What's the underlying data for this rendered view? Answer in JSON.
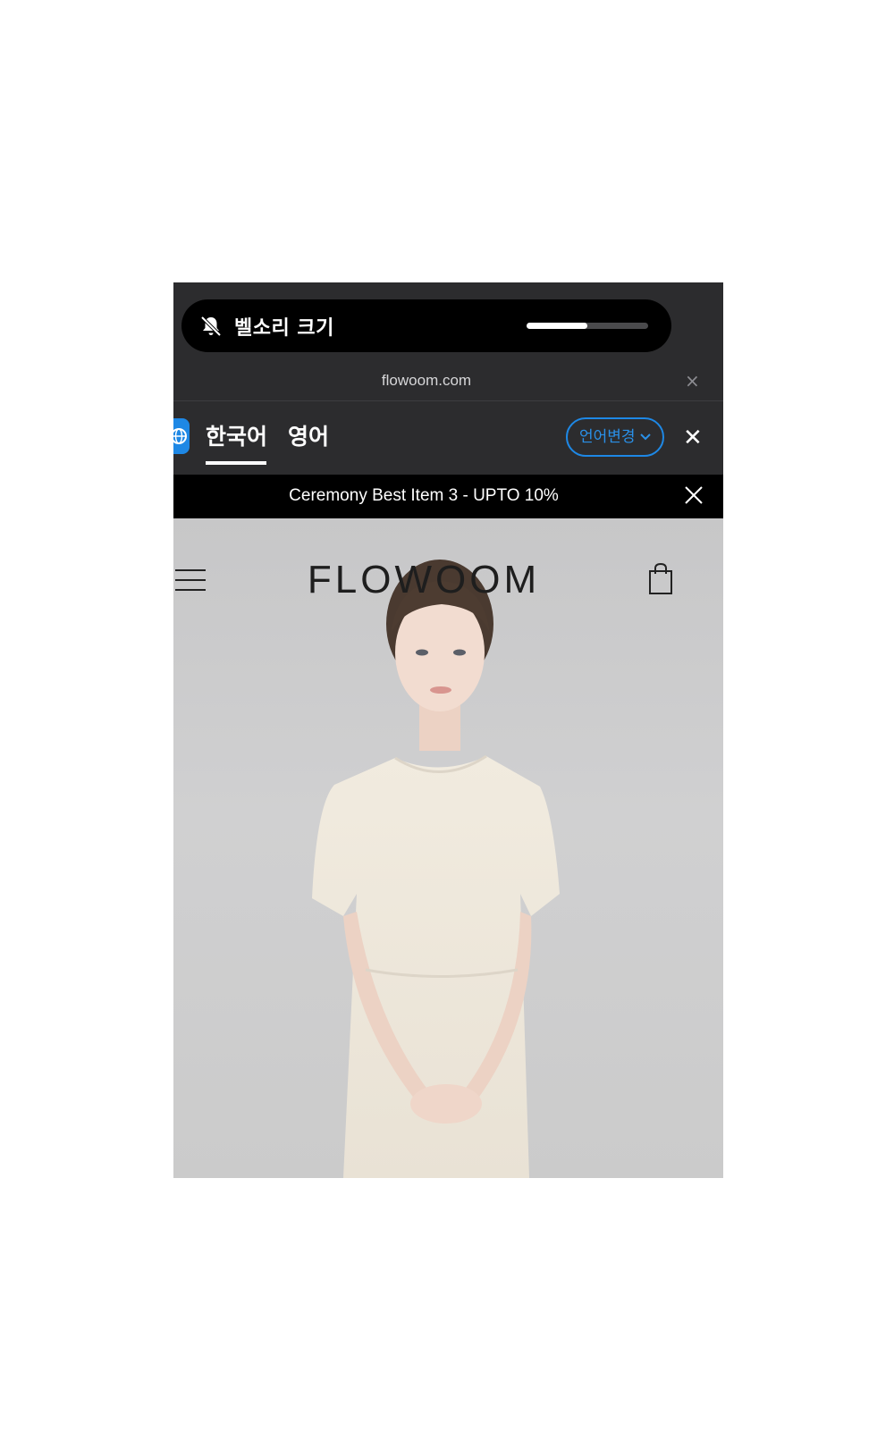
{
  "hud": {
    "label": "벨소리 크기",
    "volume_fraction": 0.5,
    "icon": "bell-slash-icon"
  },
  "url_bar": {
    "url": "flowoom.com",
    "close_label": "×"
  },
  "translate_bar": {
    "tabs": [
      {
        "label": "한국어",
        "active": true
      },
      {
        "label": "영어",
        "active": false
      }
    ],
    "change_button": "언어변경",
    "close_label": "✕"
  },
  "promo": {
    "text": "Ceremony Best Item 3 - UPTO 10%"
  },
  "site_header": {
    "logo": "FLOWOOM",
    "menu_icon": "hamburger-icon",
    "cart_icon": "shopping-bag-icon"
  },
  "colors": {
    "accent": "#1e88e5",
    "toolbar_bg": "#2c2c2e",
    "banner_bg": "#000000",
    "hero_bg": "#cbcbcb"
  }
}
